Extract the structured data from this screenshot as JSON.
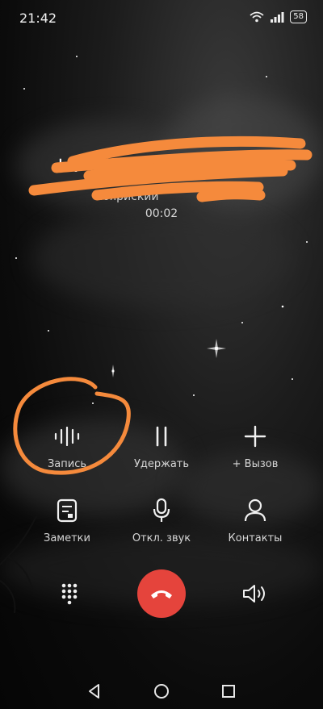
{
  "status_bar": {
    "time": "21:42",
    "battery": "58"
  },
  "call": {
    "number_visible": "+7",
    "region_visible": "нояриский",
    "duration": "00:02"
  },
  "controls_row1": [
    {
      "label": "Запись",
      "icon": "record-waveform-icon"
    },
    {
      "label": "Удержать",
      "icon": "pause-icon"
    },
    {
      "label": "+ Вызов",
      "icon": "plus-icon"
    }
  ],
  "controls_row2": [
    {
      "label": "Заметки",
      "icon": "notes-icon"
    },
    {
      "label": "Откл. звук",
      "icon": "microphone-icon"
    },
    {
      "label": "Контакты",
      "icon": "contacts-icon"
    }
  ],
  "bottom_row": [
    {
      "icon": "dialpad-icon"
    },
    {
      "icon": "end-call-icon",
      "color": "#e5443c"
    },
    {
      "icon": "speaker-icon"
    }
  ],
  "annotations": {
    "scribble_color": "#f58a3c",
    "circle_color": "#f58a3c"
  },
  "nav": [
    {
      "icon": "back-icon"
    },
    {
      "icon": "home-icon"
    },
    {
      "icon": "recents-icon"
    }
  ]
}
